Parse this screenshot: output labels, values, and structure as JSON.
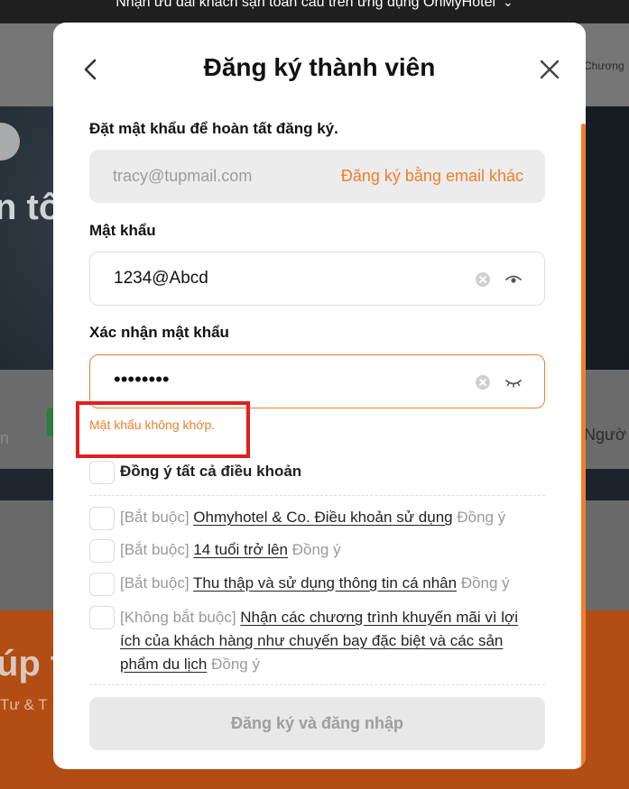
{
  "background": {
    "promo_banner": "Nhận ưu đãi khách sạn toàn cầu trên ứng dụng OhMyHotel",
    "nav_partial": "Chương",
    "hero_partial": "n tôi",
    "strip_left_partial": "n",
    "strip_right_partial": "Ngườ",
    "orange_title_partial": "úp t",
    "orange_sub_partial": "Tư & T"
  },
  "modal": {
    "title": "Đăng ký thành viên",
    "instruction": "Đặt mật khẩu để hoàn tất đăng ký.",
    "email": {
      "value": "tracy@tupmail.com",
      "alt_action": "Đăng ký bằng email khác"
    },
    "password": {
      "label": "Mật khẩu",
      "value": "1234@Abcd"
    },
    "confirm_password": {
      "label": "Xác nhận mật khẩu",
      "masked_value": "••••••••",
      "error": "Mật khẩu không khớp."
    },
    "agree_all": "Đồng ý tất cả điều khoản",
    "terms": [
      {
        "tag": "[Bắt buộc]",
        "link": "Ohmyhotel & Co. Điều khoản sử dụng",
        "agree": "Đồng ý"
      },
      {
        "tag": "[Bắt buộc]",
        "link": "14 tuổi trở lên",
        "agree": "Đồng ý"
      },
      {
        "tag": "[Bắt buộc]",
        "link": "Thu thập và sử dụng thông tin cá nhân",
        "agree": "Đồng ý"
      },
      {
        "tag": "[Không bắt buộc]",
        "link": "Nhận các chương trình khuyến mãi vì lợi ích của khách hàng như chuyến bay đặc biệt và các sản phẩm du lịch",
        "agree": "Đồng ý"
      }
    ],
    "submit_label": "Đăng ký và đăng nhập"
  },
  "colors": {
    "accent": "#f07d2e",
    "highlight": "#e02020",
    "disabled_bg": "#e8e8e8"
  }
}
